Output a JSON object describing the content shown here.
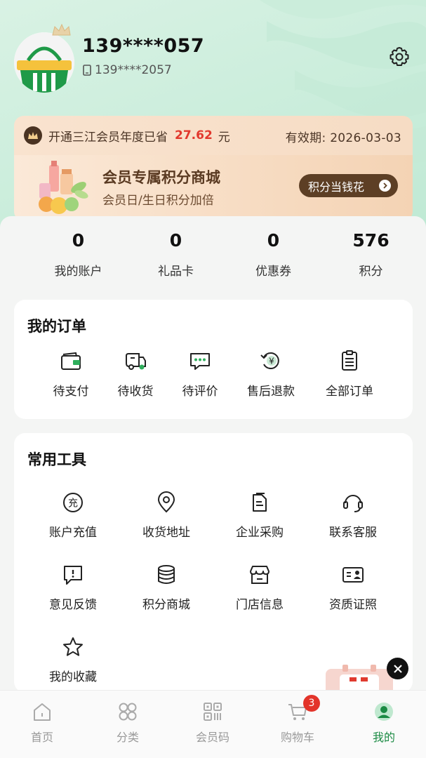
{
  "profile": {
    "username": "139****057",
    "phone": "139****2057"
  },
  "membership": {
    "saved_text": "开通三江会员年度已省",
    "saved_amount": "27.62",
    "saved_unit": "元",
    "valid_until": "有效期: 2026-03-03",
    "mall_title": "会员专属积分商城",
    "mall_subtitle": "会员日/生日积分加倍",
    "mall_button": "积分当钱花"
  },
  "stats": [
    {
      "value": "0",
      "label": "我的账户"
    },
    {
      "value": "0",
      "label": "礼品卡"
    },
    {
      "value": "0",
      "label": "优惠券"
    },
    {
      "value": "576",
      "label": "积分"
    }
  ],
  "orders": {
    "title": "我的订单",
    "items": [
      {
        "label": "待支付",
        "icon": "wallet-icon"
      },
      {
        "label": "待收货",
        "icon": "truck-icon"
      },
      {
        "label": "待评价",
        "icon": "comment-icon"
      },
      {
        "label": "售后退款",
        "icon": "refund-icon"
      },
      {
        "label": "全部订单",
        "icon": "order-list-icon"
      }
    ]
  },
  "tools": {
    "title": "常用工具",
    "items": [
      {
        "label": "账户充值",
        "icon": "recharge-icon"
      },
      {
        "label": "收货地址",
        "icon": "location-icon"
      },
      {
        "label": "企业采购",
        "icon": "document-icon"
      },
      {
        "label": "联系客服",
        "icon": "headset-icon"
      },
      {
        "label": "意见反馈",
        "icon": "feedback-icon"
      },
      {
        "label": "积分商城",
        "icon": "coins-icon"
      },
      {
        "label": "门店信息",
        "icon": "store-icon"
      },
      {
        "label": "资质证照",
        "icon": "license-icon"
      },
      {
        "label": "我的收藏",
        "icon": "star-icon"
      }
    ]
  },
  "tabbar": {
    "items": [
      {
        "label": "首页",
        "icon": "home-icon"
      },
      {
        "label": "分类",
        "icon": "category-icon"
      },
      {
        "label": "会员码",
        "icon": "qrcode-icon"
      },
      {
        "label": "购物车",
        "icon": "cart-icon",
        "badge": "3"
      },
      {
        "label": "我的",
        "icon": "profile-icon",
        "active": true
      }
    ]
  },
  "colors": {
    "accent": "#1a8a43",
    "price_red": "#e2382d",
    "vip_brown": "#5d3f25"
  }
}
